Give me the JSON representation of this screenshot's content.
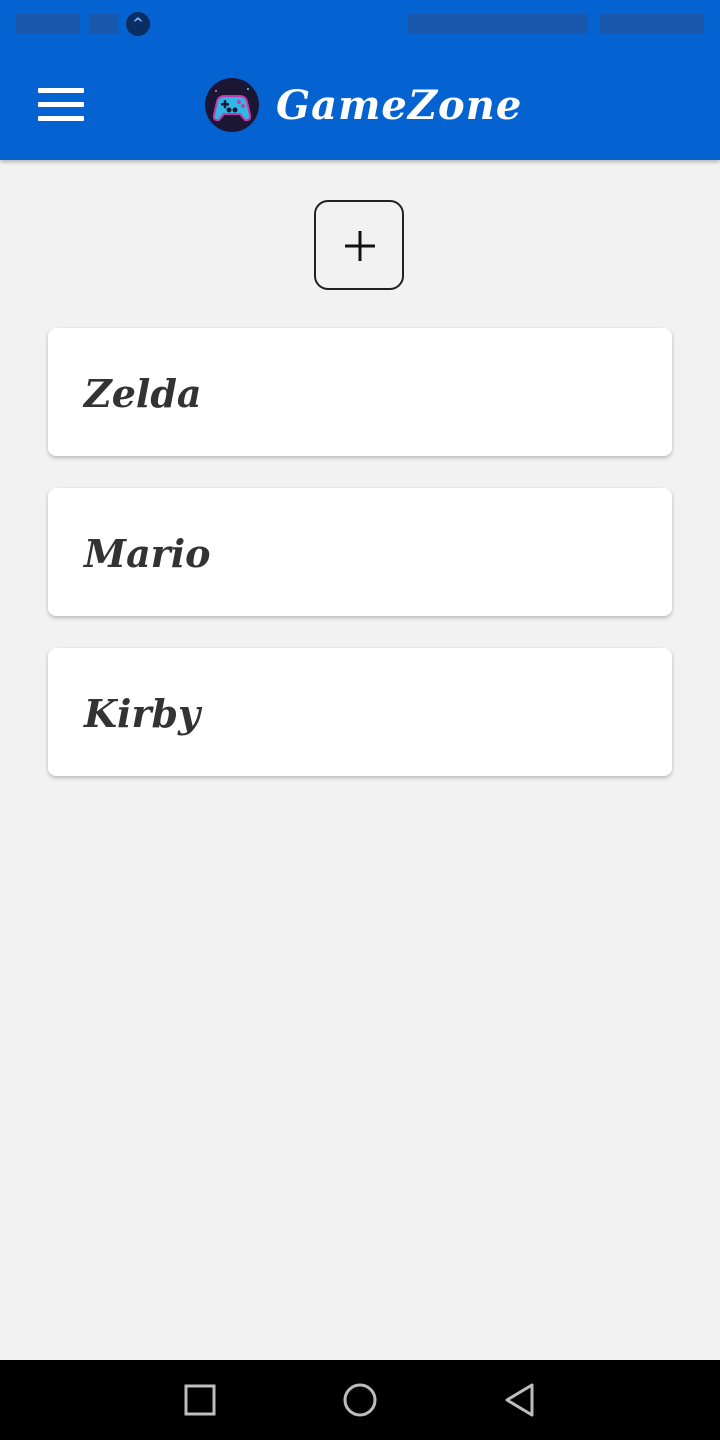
{
  "app": {
    "title": "GameZone",
    "logo_icon": "gamepad-logo-icon",
    "accent_color": "#0563d1"
  },
  "header": {
    "menu_icon": "hamburger-menu-icon"
  },
  "toolbar": {
    "add_icon": "plus-icon"
  },
  "games": [
    {
      "name": "Zelda"
    },
    {
      "name": "Mario"
    },
    {
      "name": "Kirby"
    }
  ],
  "nav": {
    "items": [
      {
        "icon": "recents-square-icon"
      },
      {
        "icon": "home-circle-icon"
      },
      {
        "icon": "back-triangle-icon"
      }
    ]
  }
}
